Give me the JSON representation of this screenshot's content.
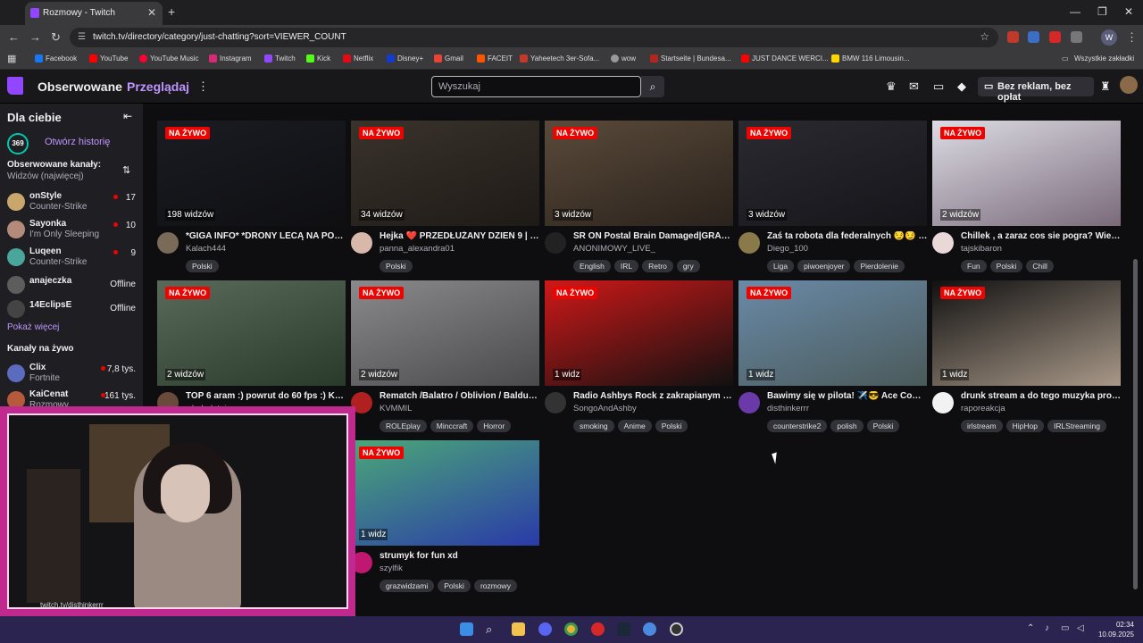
{
  "browser": {
    "tab_title": "Rozmowy - Twitch",
    "new_tab": "+",
    "url": "twitch.tv/directory/category/just-chatting?sort=VIEWER_COUNT",
    "profile_initial": "W",
    "bookmarks": [
      "Facebook",
      "YouTube",
      "YouTube Music",
      "Instagram",
      "Twitch",
      "Kick",
      "Netflix",
      "Disney+",
      "Gmail",
      "FACEIT",
      "Yaheetech 3er-Sofa...",
      "wow",
      "Startseite | Bundesa...",
      "JUST DANCE WERCI...",
      "BMW 116 Limousin..."
    ],
    "all_bookmarks": "Wszystkie zakładki"
  },
  "twitch": {
    "nav_following": "Obserwowane",
    "nav_browse": "Przeglądaj",
    "search_placeholder": "Wyszukaj",
    "turbo_label": "Bez reklam, bez opłat"
  },
  "sidebar": {
    "title": "Dla ciebie",
    "history_badge": "369",
    "history_label": "Otwórz historię",
    "followed_header": "Obserwowane kanały:",
    "followed_sort": "Widzów (najwięcej)",
    "followed": [
      {
        "name": "onStyle",
        "game": "Counter-Strike",
        "count": "17",
        "color": "#c9a66b"
      },
      {
        "name": "Sayonka",
        "game": "I'm Only Sleeping",
        "count": "10",
        "color": "#b48a7a"
      },
      {
        "name": "Luqeen",
        "game": "Counter-Strike",
        "count": "9",
        "color": "#4aa59a"
      },
      {
        "name": "anajeczka",
        "game": "",
        "count": "Offline",
        "color": "#6a5a5a"
      },
      {
        "name": "14EclipsE",
        "game": "",
        "count": "Offline",
        "color": "#444"
      }
    ],
    "show_more": "Pokaż więcej",
    "live_header": "Kanały na żywo",
    "live": [
      {
        "name": "Clix",
        "game": "Fortnite",
        "count": "7,8 tys.",
        "color": "#5b6bbd"
      },
      {
        "name": "KaiCenat",
        "game": "Rozmowy",
        "count": "161 tys.",
        "color": "#b55a3a"
      }
    ]
  },
  "webcam": {
    "caption": "twitch.tv/disthinkerrr"
  },
  "live_badge": "NA ŻYWO",
  "streams": [
    {
      "viewers": "198 widzów",
      "title": "*GIGA INFO* *DRONY LECĄ NA POLS...",
      "channel": "Kalach444",
      "tags": [
        "Polski"
      ],
      "thumb": "#1a1c22",
      "thumb2": "#0f0f12",
      "avatar": "#7a6a58"
    },
    {
      "viewers": "34 widzów",
      "title": "Hejka ❤️ PRZEDŁUŻANY DZIEŃ 9 | 1z...",
      "channel": "panna_alexandra01",
      "tags": [
        "Polski"
      ],
      "thumb": "#3a332c",
      "thumb2": "#1e1a16",
      "avatar": "#d8b8a8"
    },
    {
      "viewers": "3 widzów",
      "title": "SR ON Postal Brain Damaged|GRAMY ...",
      "channel": "ANONIMOWY_LIVE_",
      "tags": [
        "English",
        "IRL",
        "Retro",
        "gry"
      ],
      "thumb": "#5a4a3a",
      "thumb2": "#2a221c",
      "avatar": "#222"
    },
    {
      "viewers": "3 widzów",
      "title": "Zaś ta robota dla federalnych 😏😏 | !...",
      "channel": "Diego_100",
      "tags": [
        "Liga",
        "piwoenjoyer",
        "Pierdolenie"
      ],
      "thumb": "#2a2a30",
      "thumb2": "#15151a",
      "avatar": "#8a7a4a"
    },
    {
      "viewers": "2 widzów",
      "title": "Chillek , a zaraz cos sie pogra? Wiesiu?",
      "channel": "tajskibaron",
      "tags": [
        "Fun",
        "Polski",
        "Chill"
      ],
      "thumb": "#dcdce4",
      "thumb2": "#7a6a7a",
      "avatar": "#e8d8d8"
    },
    {
      "viewers": "2 widzów",
      "title": "TOP 6 aram :) powrut do 60 fps :) KC ...",
      "channel": "wbabelatnie",
      "tags": [],
      "thumb": "#5a6a5a",
      "thumb2": "#2a3a2a",
      "avatar": "#6a4a3a"
    },
    {
      "viewers": "2 widzów",
      "title": "Rematch /Balatro / Oblivion / Baldurs ...",
      "channel": "KVMMIL",
      "tags": [
        "ROLEplay",
        "Minccraft",
        "Horror"
      ],
      "thumb": "#8a8a8c",
      "thumb2": "#4a4a4c",
      "avatar": "#b02020"
    },
    {
      "viewers": "1 widz",
      "title": "Radio Ashbys Rock z zakrapianym twi...",
      "channel": "SongoAndAshby",
      "tags": [
        "smoking",
        "Anime",
        "Polski"
      ],
      "thumb": "#d01818",
      "thumb2": "#111",
      "avatar": "#333"
    },
    {
      "viewers": "1 widz",
      "title": "Bawimy się w pilota! ✈️😎 Ace Comb...",
      "channel": "disthinkerrr",
      "tags": [
        "counterstrike2",
        "polish",
        "Polski"
      ],
      "thumb": "#6a8aa8",
      "thumb2": "#4a5a5a",
      "avatar": "#6a3aa8"
    },
    {
      "viewers": "1 widz",
      "title": "drunk stream a do tego muzyka profe...",
      "channel": "raporeakcja",
      "tags": [
        "irlstream",
        "HipHop",
        "IRLStreaming"
      ],
      "thumb": "#111",
      "thumb2": "#a89888",
      "avatar": "#f2f2f2"
    },
    {
      "viewers": "1 widz",
      "title": "strumyk for fun xd",
      "channel": "szylfik",
      "tags": [
        "grazwidzami",
        "Polski",
        "rozmowy"
      ],
      "thumb": "#4aa878",
      "thumb2": "#2a3aa8",
      "avatar": "#c01870"
    }
  ],
  "taskbar": {
    "time": "02:34",
    "date": "10.09.2025"
  }
}
